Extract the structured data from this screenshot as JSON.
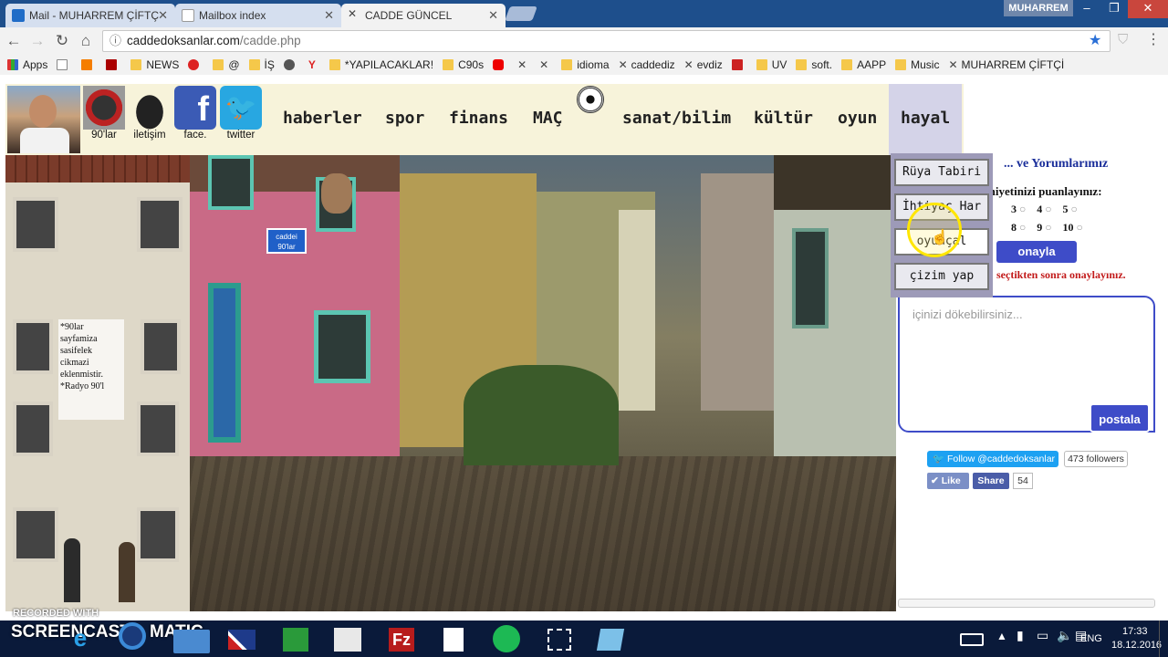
{
  "browser": {
    "tabs": [
      {
        "title": "Mail - MUHARREM ÇİFTÇ",
        "icon": "outlook-icon"
      },
      {
        "title": "Mailbox index",
        "icon": "page-icon"
      },
      {
        "title": "CADDE GÜNCEL",
        "icon": "cadde-icon",
        "active": true
      }
    ],
    "user": "MUHARREM",
    "url_host": "caddedoksanlar.com",
    "url_path": "/cadde.php",
    "bookmarks": [
      "Apps",
      "NEWS",
      "@",
      "İŞ",
      "*YAPILACAKLAR!",
      "C90s",
      "idioma",
      "caddediz",
      "evdiz",
      "UV",
      "soft.",
      "AAPP",
      "Music",
      "MUHARREM ÇİFTÇİ"
    ]
  },
  "site": {
    "social": [
      {
        "label": "90'lar",
        "icon": "cassette-icon"
      },
      {
        "label": "iletişim",
        "icon": "telephone-icon"
      },
      {
        "label": "face.",
        "icon": "facebook-icon"
      },
      {
        "label": "twitter",
        "icon": "twitter-icon"
      }
    ],
    "menu": [
      "haberler",
      "spor",
      "finans",
      "MAÇ",
      "sanat/bilim",
      "kültür",
      "oyun",
      "hayal"
    ],
    "dropdown": [
      "Rüya Tabiri",
      "İhtiyaç Har",
      "oyunçal",
      "çizim yap"
    ],
    "left_text": "*90lar sayfamiza sasifelek cikmazi eklenmistir. *Radyo 90'l",
    "sign_text": "caddei 90'lar",
    "survey": {
      "title": "... ve Yorumlarımız",
      "question": "...memnuniyetinizi puanlayınız:",
      "options": [
        "3",
        "4",
        "5",
        "8",
        "9",
        "10"
      ],
      "confirm": "onayla",
      "note": "seçtikten sonra onaylayınız."
    },
    "comment": {
      "placeholder": "içinizi dökebilirsiniz...",
      "post": "postala"
    },
    "twitter": {
      "follow": "Follow @caddedoksanlar",
      "followers": "473 followers"
    },
    "facebook": {
      "like": "Like",
      "share": "Share",
      "count": "54"
    }
  },
  "watermark": {
    "line1": "RECORDED WITH",
    "line2": "SCREENCAST",
    "line3": "MATIC"
  },
  "taskbar": {
    "lang": "ENG",
    "time": "17:33",
    "date": "18.12.2016"
  }
}
